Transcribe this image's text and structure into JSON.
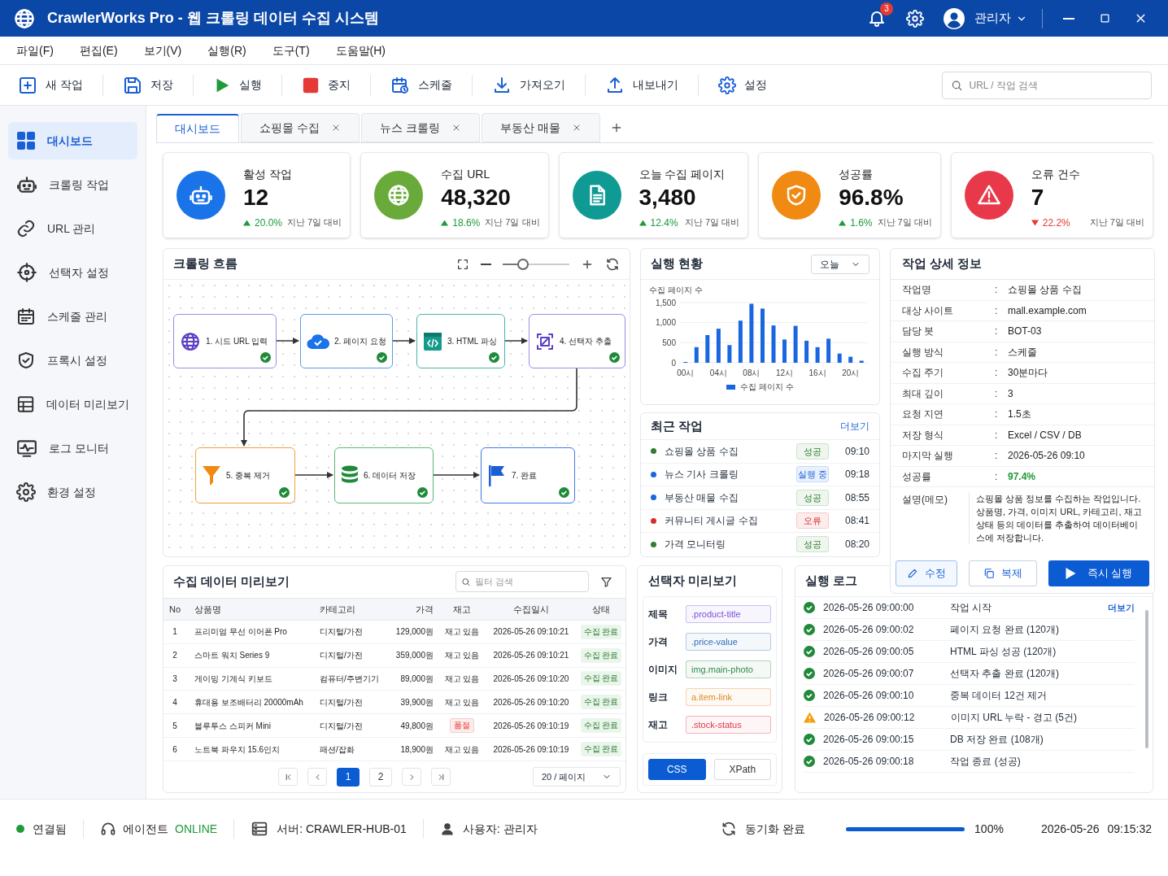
{
  "window": {
    "title": "CrawlerWorks Pro - 웹 크롤링 데이터 수집 시스템",
    "notification_count": "3",
    "user": "관리자"
  },
  "menu": [
    "파일(F)",
    "편집(E)",
    "보기(V)",
    "실행(R)",
    "도구(T)",
    "도움말(H)"
  ],
  "toolbar": {
    "buttons": [
      "새 작업",
      "저장",
      "실행",
      "중지",
      "스케줄",
      "가져오기",
      "내보내기",
      "설정"
    ],
    "search": {
      "placeholder": "URL / 작업 검색"
    }
  },
  "sidebar": {
    "items": [
      {
        "label": "대시보드",
        "selected": true
      },
      {
        "label": "크롤링 작업",
        "selected": false
      },
      {
        "label": "URL 관리",
        "selected": false
      },
      {
        "label": "선택자 설정",
        "selected": false
      },
      {
        "label": "스케줄 관리",
        "selected": false
      },
      {
        "label": "프록시 설정",
        "selected": false
      },
      {
        "label": "데이터 미리보기",
        "selected": false
      },
      {
        "label": "로그 모니터",
        "selected": false
      },
      {
        "label": "환경 설정",
        "selected": false
      }
    ]
  },
  "tabs": [
    {
      "label": "대시보드",
      "selected": true,
      "closable": false
    },
    {
      "label": "쇼핑몰 수집",
      "selected": false,
      "closable": true
    },
    {
      "label": "뉴스 크롤링",
      "selected": false,
      "closable": true
    },
    {
      "label": "부동산 매물",
      "selected": false,
      "closable": true
    }
  ],
  "kpis": [
    {
      "label": "활성 작업",
      "value": "12",
      "rising": true,
      "delta": "20.0%",
      "note": "지난 7일 대비",
      "color": "#1a73e8"
    },
    {
      "label": "수집 URL",
      "value": "48,320",
      "rising": true,
      "delta": "18.6%",
      "note": "지난 7일 대비",
      "color": "#6aaa3a"
    },
    {
      "label": "오늘 수집 페이지",
      "value": "3,480",
      "rising": true,
      "delta": "12.4%",
      "note": "지난 7일 대비",
      "color": "#0f9a94"
    },
    {
      "label": "성공률",
      "value": "96.8%",
      "rising": true,
      "delta": "1.6%",
      "note": "지난 7일 대비",
      "color": "#f08a12"
    },
    {
      "label": "오류 건수",
      "value": "7",
      "rising": false,
      "delta": "22.2%",
      "note": "지난 7일 대비",
      "color": "#e8394a"
    }
  ],
  "flow": {
    "title": "크롤링 흐름",
    "zoom": {
      "level": 0.3
    },
    "nodes": [
      {
        "label": "1. 시드 URL 입력",
        "color": "#9b8ce6",
        "completed": true
      },
      {
        "label": "2. 페이지 요청",
        "color": "#5a9be6",
        "completed": true
      },
      {
        "label": "3. HTML 파싱",
        "color": "#4db3a8",
        "completed": true
      },
      {
        "label": "4. 선택자 추출",
        "color": "#9b8ce6",
        "completed": true
      },
      {
        "label": "5. 중복 제거",
        "color": "#f0a040",
        "completed": true
      },
      {
        "label": "6. 데이터 저장",
        "color": "#5cb870",
        "completed": true
      },
      {
        "label": "7. 완료",
        "color": "#3d7be0",
        "completed": true
      }
    ]
  },
  "run_status": {
    "title": "실행 현황",
    "period": "오늘",
    "chart_data": {
      "type": "bar",
      "ylabel": "수집 페이지 수",
      "categories": [
        "00시",
        null,
        null,
        "04시",
        null,
        null,
        "08시",
        null,
        null,
        "12시",
        null,
        null,
        "16시",
        null,
        null,
        "20시",
        null
      ],
      "ylim": [
        0,
        1500
      ],
      "yticks": [
        {
          "value": 0,
          "label": "0"
        },
        {
          "value": 500,
          "label": "500"
        },
        {
          "value": 1000,
          "label": "1,000"
        },
        {
          "value": 1500,
          "label": "1,500"
        }
      ],
      "series": [
        {
          "name": "수집 페이지 수",
          "color": "#1a66e0",
          "values": [
            20,
            390,
            690,
            850,
            440,
            1050,
            1470,
            1350,
            930,
            580,
            920,
            550,
            390,
            600,
            230,
            150,
            50
          ]
        }
      ]
    }
  },
  "recent_jobs": {
    "title": "최근 작업",
    "more": "더보기",
    "items": [
      {
        "name": "쇼핑몰 상품 수집",
        "status": "성공",
        "kind": "success",
        "time": "09:10",
        "color": "#2e7d32"
      },
      {
        "name": "뉴스 기사 크롤링",
        "status": "실행 중",
        "kind": "running",
        "time": "09:18",
        "color": "#1a66e0"
      },
      {
        "name": "부동산 매물 수집",
        "status": "성공",
        "kind": "success",
        "time": "08:55",
        "color": "#1a66e0"
      },
      {
        "name": "커뮤니티 게시글 수집",
        "status": "오류",
        "kind": "error",
        "time": "08:41",
        "color": "#d32f2f"
      },
      {
        "name": "가격 모니터링",
        "status": "성공",
        "kind": "success",
        "time": "08:20",
        "color": "#2e7d32"
      }
    ]
  },
  "job_detail": {
    "title": "작업 상세 정보",
    "fields": [
      {
        "label": "작업명",
        "separator": ":",
        "value": "쇼핑몰 상품 수집",
        "highlight": false
      },
      {
        "label": "대상 사이트",
        "separator": ":",
        "value": "mall.example.com",
        "highlight": false
      },
      {
        "label": "담당 봇",
        "separator": ":",
        "value": "BOT-03",
        "highlight": false
      },
      {
        "label": "실행 방식",
        "separator": ":",
        "value": "스케줄",
        "highlight": false
      },
      {
        "label": "수집 주기",
        "separator": ":",
        "value": "30분마다",
        "highlight": false
      },
      {
        "label": "최대 깊이",
        "separator": ":",
        "value": "3",
        "highlight": false
      },
      {
        "label": "요청 지연",
        "separator": ":",
        "value": "1.5초",
        "highlight": false
      },
      {
        "label": "저장 형식",
        "separator": ":",
        "value": "Excel / CSV / DB",
        "highlight": false
      },
      {
        "label": "마지막 실행",
        "separator": ":",
        "value": "2026-05-26 09:10",
        "highlight": false
      },
      {
        "label": "성공률",
        "separator": ":",
        "value": "97.4%",
        "highlight": true
      }
    ],
    "memo": {
      "label": "설명(메모)",
      "text": "쇼핑몰 상품 정보를 수집하는 작업입니다. 상품명, 가격, 이미지 URL, 카테고리, 재고 상태 등의 데이터를 추출하여 데이터베이스에 저장합니다."
    },
    "buttons": [
      {
        "label": "수정",
        "kind": "edit"
      },
      {
        "label": "복제",
        "kind": "copy"
      },
      {
        "label": "즉시 실행",
        "kind": "run"
      }
    ]
  },
  "data_preview": {
    "title": "수집 데이터 미리보기",
    "filter": {
      "placeholder": "필터 검색"
    },
    "columns": [
      "No",
      "상품명",
      "카테고리",
      "가격",
      "재고",
      "수집일시",
      "상태"
    ],
    "rows": [
      {
        "no": "1",
        "name": "프리미엄 무선 이어폰 Pro",
        "category": "디지털/가전",
        "price": "129,000원",
        "stock": "재고 있음",
        "stock_out": false,
        "collected_at": "2026-05-26 09:10:21",
        "status": "수집 완료"
      },
      {
        "no": "2",
        "name": "스마트 워치 Series 9",
        "category": "디지털/가전",
        "price": "359,000원",
        "stock": "재고 있음",
        "stock_out": false,
        "collected_at": "2026-05-26 09:10:21",
        "status": "수집 완료"
      },
      {
        "no": "3",
        "name": "게이밍 기계식 키보드",
        "category": "컴퓨터/주변기기",
        "price": "89,000원",
        "stock": "재고 있음",
        "stock_out": false,
        "collected_at": "2026-05-26 09:10:20",
        "status": "수집 완료"
      },
      {
        "no": "4",
        "name": "휴대용 보조배터리 20000mAh",
        "category": "디지털/가전",
        "price": "39,900원",
        "stock": "재고 있음",
        "stock_out": false,
        "collected_at": "2026-05-26 09:10:20",
        "status": "수집 완료"
      },
      {
        "no": "5",
        "name": "블루투스 스피커 Mini",
        "category": "디지털/가전",
        "price": "49,800원",
        "stock": "품절",
        "stock_out": true,
        "collected_at": "2026-05-26 09:10:19",
        "status": "수집 완료"
      },
      {
        "no": "6",
        "name": "노트북 파우치 15.6인치",
        "category": "패션/잡화",
        "price": "18,900원",
        "stock": "재고 있음",
        "stock_out": false,
        "collected_at": "2026-05-26 09:10:19",
        "status": "수집 완료"
      }
    ],
    "pagination": {
      "pages": [
        {
          "label": "1",
          "selected": true
        },
        {
          "label": "2",
          "selected": false
        }
      ],
      "page_size": "20 / 페이지"
    }
  },
  "selector_preview": {
    "title": "선택자 미리보기",
    "rows": [
      {
        "label": "제목",
        "selector": ".product-title",
        "color": "#7b4fd6"
      },
      {
        "label": "가격",
        "selector": ".price-value",
        "color": "#2f6fb8"
      },
      {
        "label": "이미지",
        "selector": "img.main-photo",
        "color": "#2e8b4a"
      },
      {
        "label": "링크",
        "selector": "a.item-link",
        "color": "#e08a1e"
      },
      {
        "label": "재고",
        "selector": ".stock-status",
        "color": "#e0374a"
      }
    ],
    "modes": [
      {
        "label": "CSS",
        "selected": true
      },
      {
        "label": "XPath",
        "selected": false
      }
    ]
  },
  "run_log": {
    "title": "실행 로그",
    "more": "더보기",
    "entries": [
      {
        "warning": false,
        "time": "2026-05-26 09:00:00",
        "message": "작업 시작"
      },
      {
        "warning": false,
        "time": "2026-05-26 09:00:02",
        "message": "페이지 요청 완료 (120개)"
      },
      {
        "warning": false,
        "time": "2026-05-26 09:00:05",
        "message": "HTML 파싱 성공 (120개)"
      },
      {
        "warning": false,
        "time": "2026-05-26 09:00:07",
        "message": "선택자 추출 완료 (120개)"
      },
      {
        "warning": false,
        "time": "2026-05-26 09:00:10",
        "message": "중복 데이터 12건 제거"
      },
      {
        "warning": true,
        "time": "2026-05-26 09:00:12",
        "message": "이미지 URL 누락 - 경고 (5건)"
      },
      {
        "warning": false,
        "time": "2026-05-26 09:00:15",
        "message": "DB 저장 완료 (108개)"
      },
      {
        "warning": false,
        "time": "2026-05-26 09:00:18",
        "message": "작업 종료 (성공)"
      }
    ]
  },
  "status_bar": {
    "connection": "연결됨",
    "connected": true,
    "agent_label": "에이전트",
    "agent_state": "ONLINE",
    "server": "서버: CRAWLER-HUB-01",
    "user": "사용자: 관리자",
    "sync": "동기화 완료",
    "progress": {
      "level": 1,
      "reading": "100%"
    },
    "date": "2026-05-26",
    "time": "09:15:32"
  }
}
